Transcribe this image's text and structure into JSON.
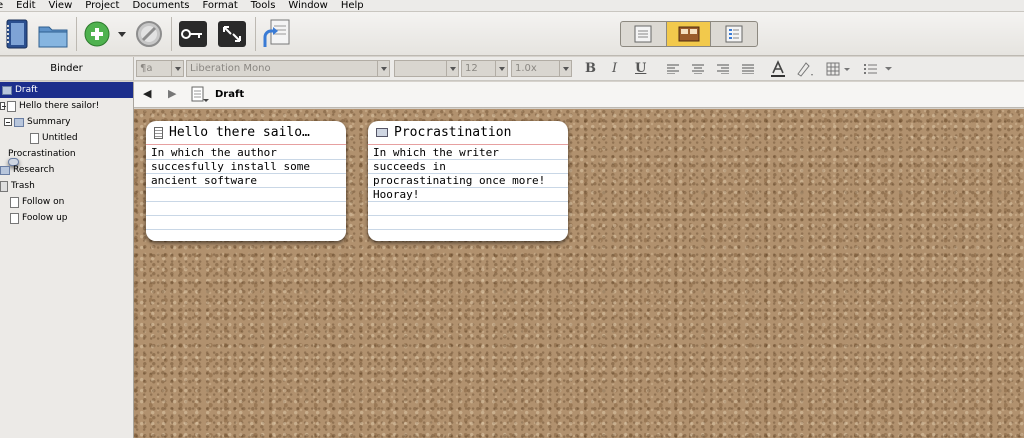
{
  "menu": {
    "items": [
      "e",
      "Edit",
      "View",
      "Project",
      "Documents",
      "Format",
      "Tools",
      "Window",
      "Help"
    ]
  },
  "toolbar": {
    "icons": [
      "binder-icon",
      "collections-icon",
      "add-icon",
      "dropdown-arrow-icon",
      "delete-icon",
      "keywords-icon",
      "fullscreen-icon",
      "compile-icon",
      "view-scrivenings-icon",
      "view-corkboard-icon",
      "view-outline-icon"
    ]
  },
  "binder": {
    "header": "Binder",
    "items": [
      {
        "label": "Draft",
        "icon": "folder-icon"
      },
      {
        "label": "Hello there sailor!",
        "icon": "document-icon"
      },
      {
        "label": "Summary",
        "icon": "folder-icon"
      },
      {
        "label": "Untitled",
        "icon": "document-icon"
      },
      {
        "label": "Procrastination",
        "icon": "card-icon"
      },
      {
        "label": "Research",
        "icon": "folder-icon"
      },
      {
        "label": "Trash",
        "icon": "trash-icon"
      },
      {
        "label": "Follow on",
        "icon": "document-icon"
      },
      {
        "label": "Foolow up",
        "icon": "document-icon"
      }
    ]
  },
  "format": {
    "style": "¶a",
    "font": "Liberation Mono",
    "weight": "",
    "size": "12",
    "spacing": "1.0x",
    "bold": "B",
    "italic": "I",
    "underline": "U"
  },
  "editor": {
    "breadcrumb": "Draft",
    "back": "◀",
    "forward": "▶"
  },
  "cards": [
    {
      "title": "Hello there sailo…",
      "synopsis": "In which the author\nsuccesfully install some\nancient software"
    },
    {
      "title": "Procrastination",
      "synopsis": "In which the writer\nsucceeds in\nprocrastinating once more!\nHooray!"
    }
  ],
  "colors": {
    "selection": "#1c2e8c",
    "cork": "#b1916e",
    "view_active": "#f2c94c"
  }
}
